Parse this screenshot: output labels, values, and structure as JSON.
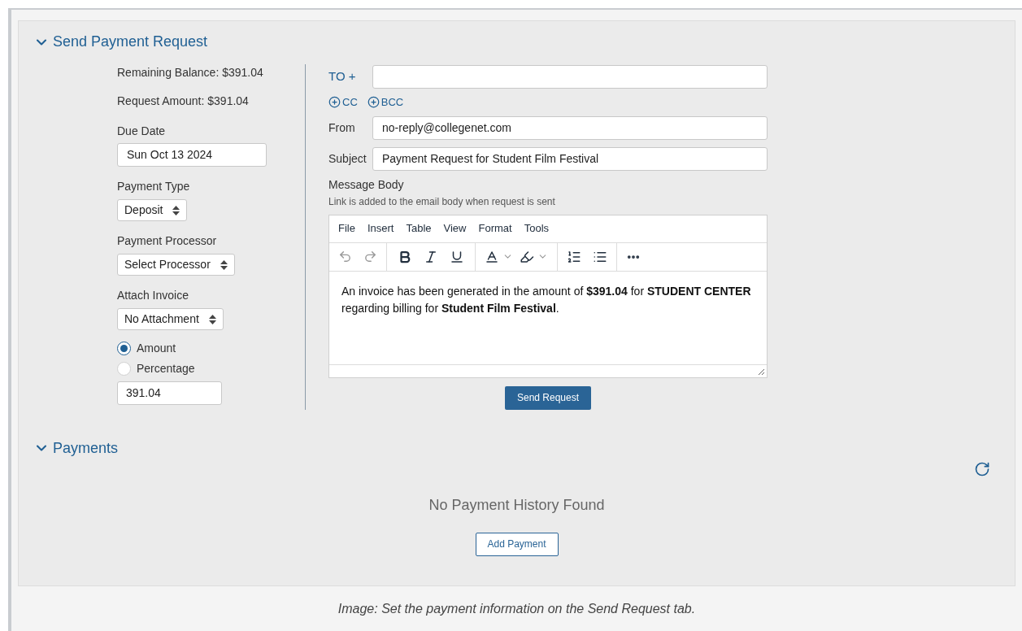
{
  "request_section": {
    "title": "Send Payment Request",
    "expanded": true,
    "remaining_balance": "Remaining Balance: $391.04",
    "request_amount": "Request Amount: $391.04",
    "due_date": {
      "label": "Due Date",
      "value": "Sun Oct 13 2024"
    },
    "selects": [
      {
        "label": "Payment Type",
        "value": "Deposit"
      },
      {
        "label": "Payment Processor",
        "value": "Select Processor"
      },
      {
        "label": "Attach Invoice",
        "value": "No Attachment"
      }
    ],
    "amount_options": [
      {
        "label": "Amount",
        "selected": true
      },
      {
        "label": "Percentage",
        "selected": false
      }
    ],
    "amount_value": "391.04",
    "email": {
      "to_label": "TO +",
      "cc": "CC",
      "bcc": "BCC",
      "from_label": "From",
      "from_value": "no-reply@collegenet.com",
      "subject_label": "Subject",
      "subject_value": "Payment Request for Student Film Festival",
      "body_label": "Message Body",
      "body_hint": "Link is added to the email body when request is sent",
      "menu": [
        "File",
        "Insert",
        "Table",
        "View",
        "Format",
        "Tools"
      ],
      "body_text": "An invoice has been generated in the amount of **$391.04** for **STUDENT CENTER** regarding billing for **Student Film Festival**."
    },
    "send_button": "Send Request"
  },
  "payments_section": {
    "title": "Payments",
    "expanded": true,
    "empty_message": "No Payment History Found",
    "add_button": "Add Payment"
  },
  "caption": "Image: Set the payment information on the Send Request tab."
}
